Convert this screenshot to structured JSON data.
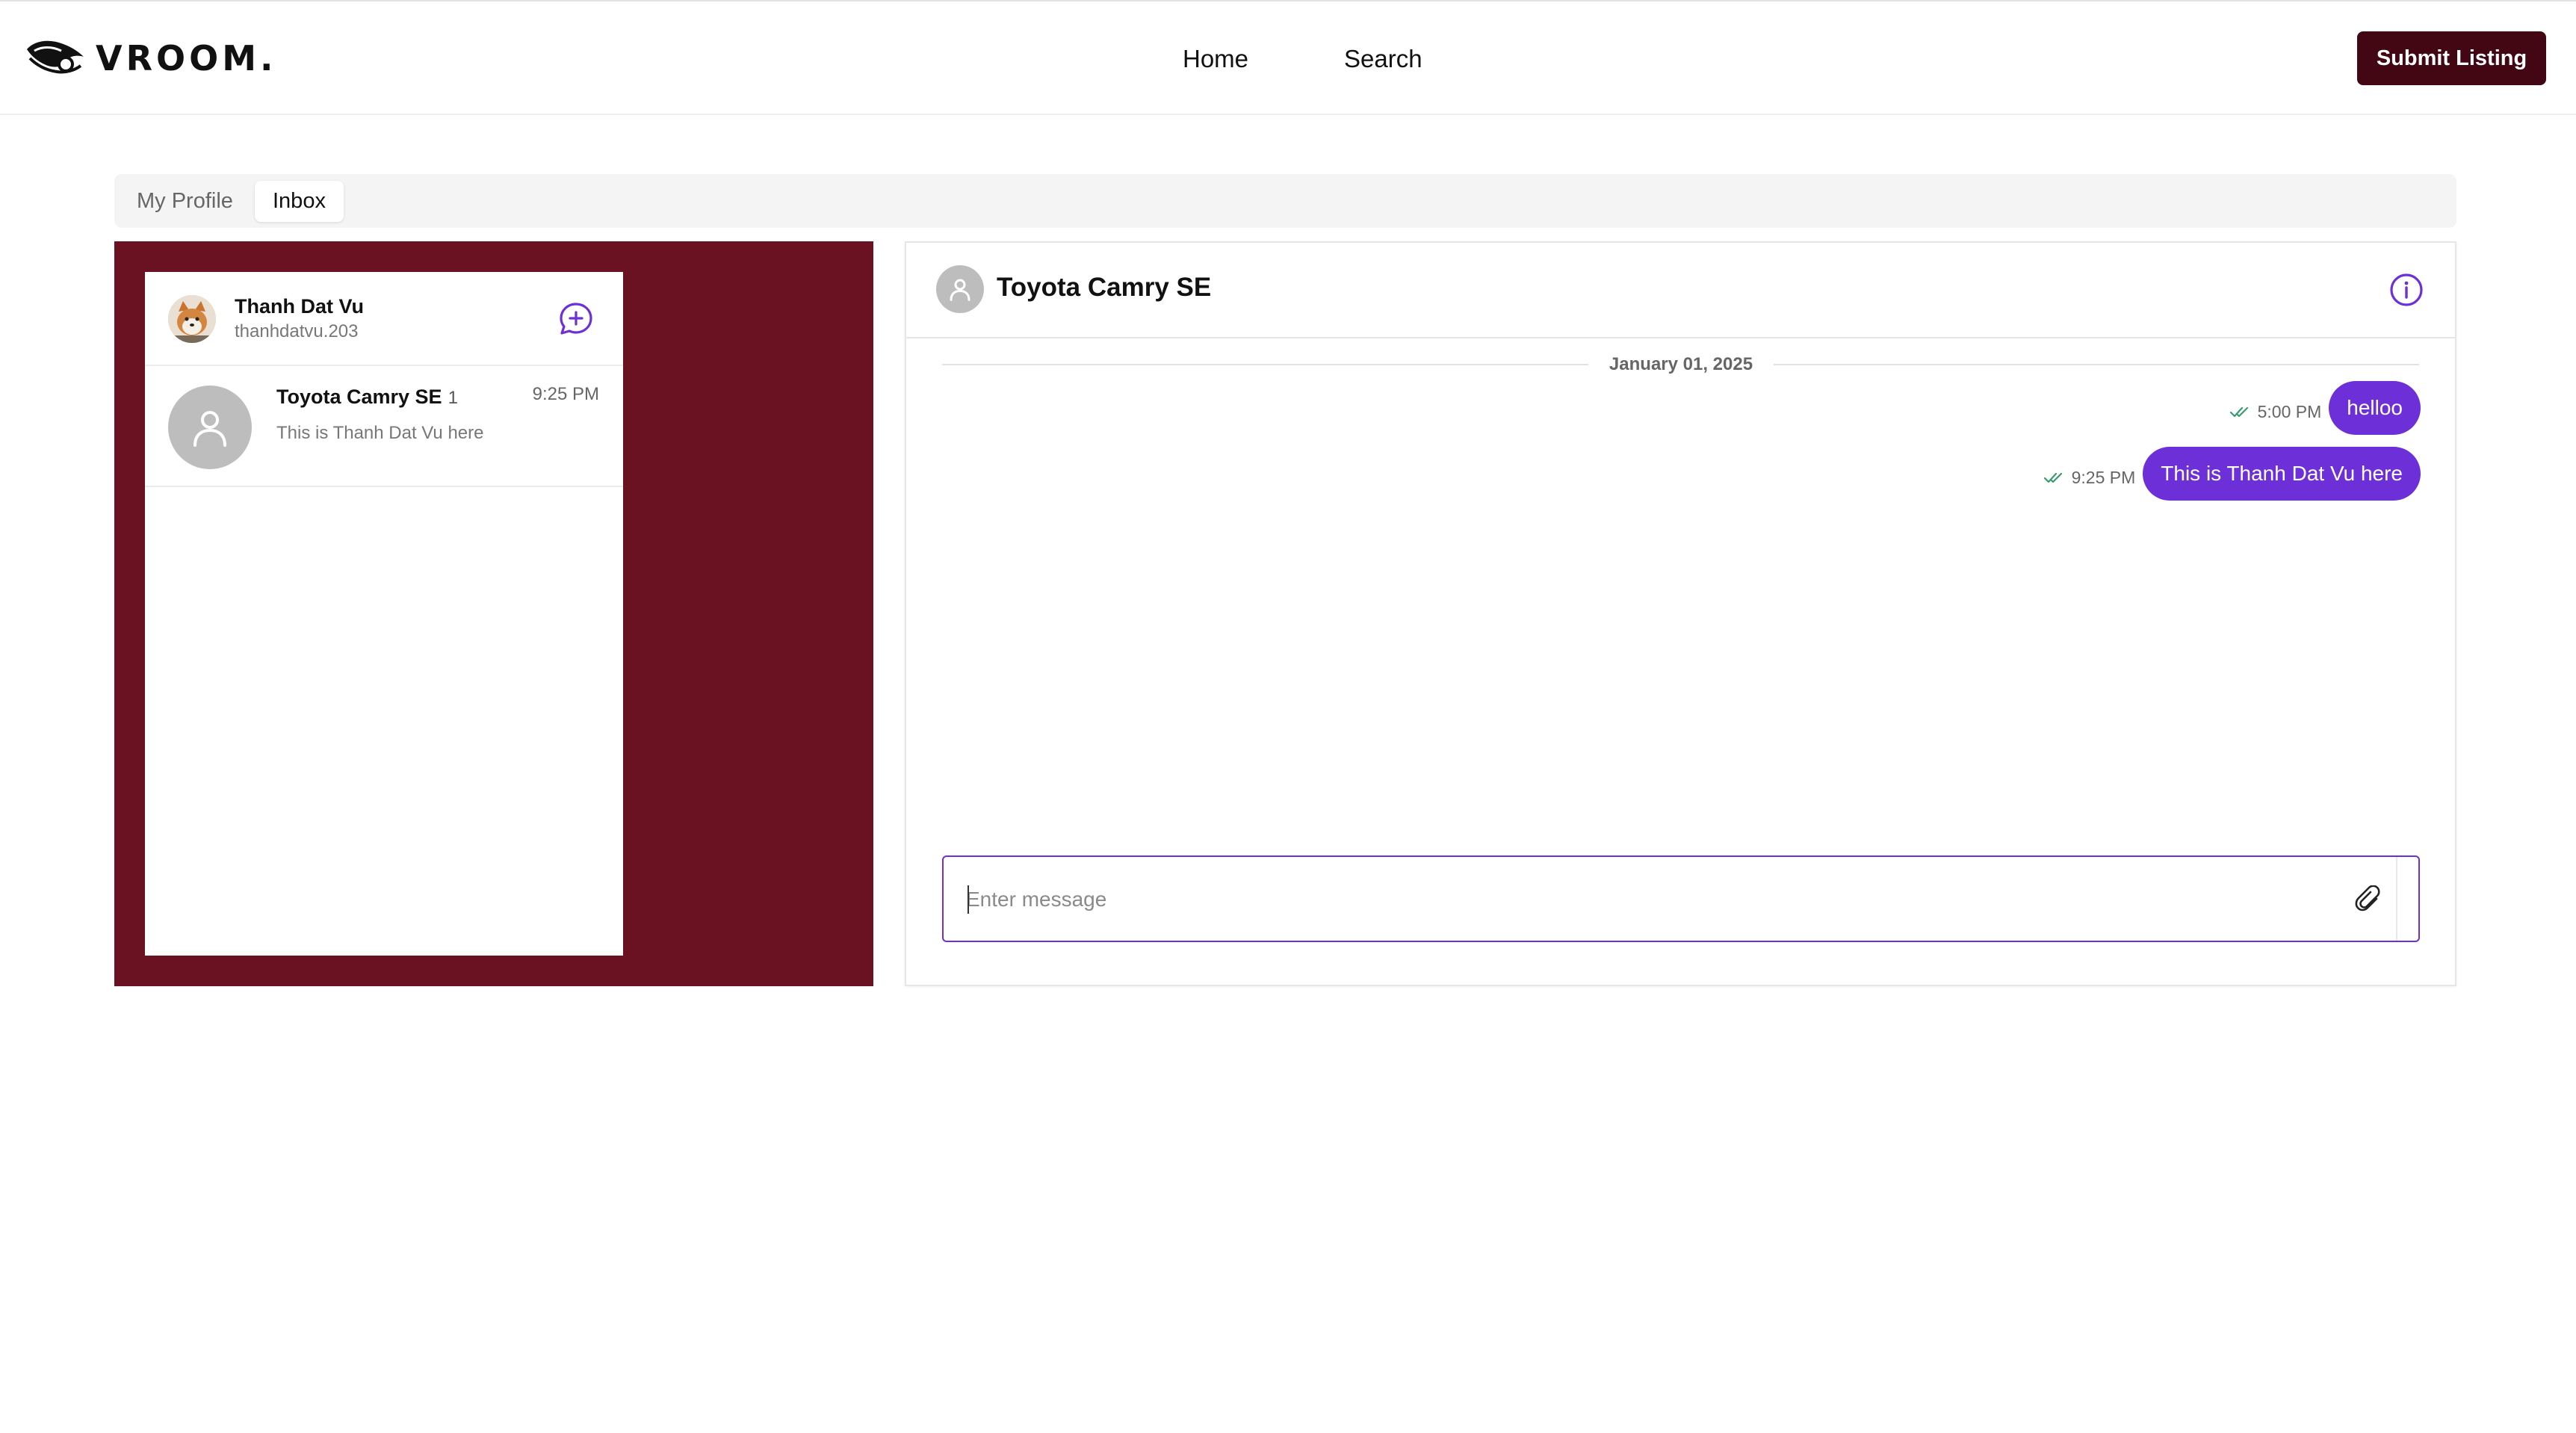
{
  "header": {
    "logo_text": "VROOM.",
    "nav": [
      {
        "label": "Home"
      },
      {
        "label": "Search"
      }
    ],
    "submit_label": "Submit Listing"
  },
  "tabs": [
    {
      "label": "My Profile",
      "active": false
    },
    {
      "label": "Inbox",
      "active": true
    }
  ],
  "inbox": {
    "user": {
      "name": "Thanh Dat Vu",
      "handle": "thanhdatvu.203"
    },
    "conversations": [
      {
        "title": "Toyota Camry SE",
        "unread": "1",
        "time": "9:25 PM",
        "preview": "This is Thanh Dat Vu here"
      }
    ]
  },
  "chat": {
    "title": "Toyota Camry SE",
    "date": "January 01, 2025",
    "messages": [
      {
        "text": "helloo",
        "time": "5:00 PM",
        "status_icon": "double-check-icon"
      },
      {
        "text": "This is Thanh Dat Vu here",
        "time": "9:25 PM",
        "status_icon": "double-check-icon"
      }
    ],
    "composer_placeholder": "Enter message"
  },
  "colors": {
    "brand_dark": "#420713",
    "panel_maroon": "#6b1222",
    "accent_purple": "#6d2fd8",
    "read_check": "#3a9b6e"
  }
}
